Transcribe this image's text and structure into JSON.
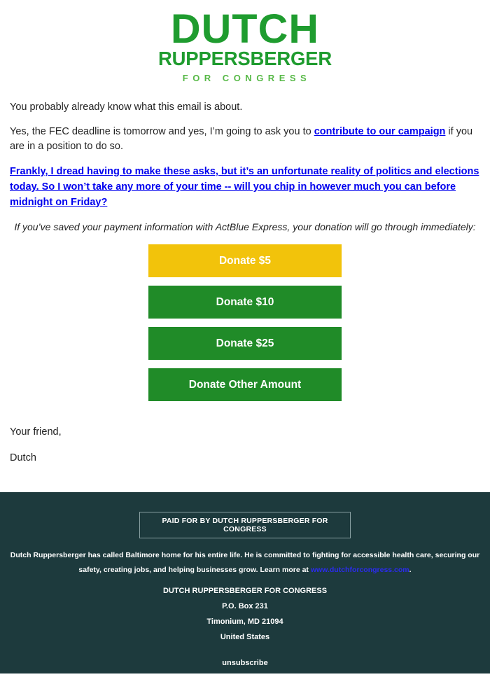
{
  "logo": {
    "line1": "DUTCH",
    "line2": "RUPPERSBERGER",
    "line3": "FOR CONGRESS",
    "primary_color": "#1f9c2f",
    "secondary_color": "#57b947"
  },
  "body": {
    "para1": "You probably already know what this email is about.",
    "para2_before": "Yes, the FEC deadline is tomorrow and yes, I’m going to ask you to ",
    "para2_link": "contribute to our campaign",
    "para2_after": " if you are in a position to do so.",
    "para3_link": "Frankly, I dread having to make these asks, but it’s an unfortunate reality of politics and elections today. So I won’t take any more of your time -- will you chip in however much you can before midnight on Friday?",
    "actblue_note": "If you’ve saved your payment information with ActBlue Express, your donation will go through immediately:",
    "link_color": "#0000ee"
  },
  "donate_buttons": [
    {
      "label": "Donate $5",
      "color": "#f2c30b",
      "style": "yellow"
    },
    {
      "label": "Donate $10",
      "color": "#208b28",
      "style": "green"
    },
    {
      "label": "Donate $25",
      "color": "#208b28",
      "style": "green"
    },
    {
      "label": "Donate Other Amount",
      "color": "#208b28",
      "style": "green"
    }
  ],
  "signature": {
    "closing": "Your friend,",
    "name": "Dutch"
  },
  "footer": {
    "background_color": "#1d3a3d",
    "paid_for": "PAID FOR BY DUTCH RUPPERSBERGER FOR CONGRESS",
    "blurb_before": "Dutch Ruppersberger has called Baltimore home for his entire life. He is committed to fighting for accessible health care, securing our safety, creating jobs, and helping businesses grow. Learn more at ",
    "blurb_link": "www.dutchforcongress.com",
    "blurb_after": ".",
    "blurb_link_color": "#2b2bee",
    "address": [
      "DUTCH RUPPERSBERGER FOR CONGRESS",
      "P.O. Box 231",
      "Timonium, MD 21094",
      "United States"
    ],
    "unsubscribe": "unsubscribe"
  }
}
